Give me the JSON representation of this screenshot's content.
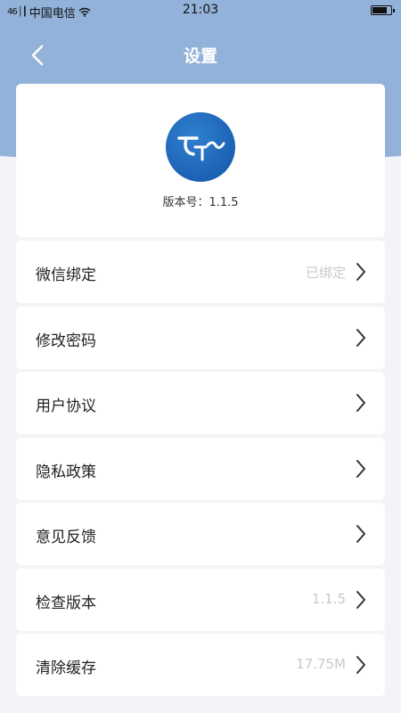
{
  "status": {
    "signal": "46 │┃",
    "carrier": "中国电信",
    "time": "21:03"
  },
  "nav": {
    "title": "设置",
    "back_icon": "chevron-left-icon"
  },
  "about": {
    "logo_icon": "app-logo-icon",
    "version_text": "版本号：1.1.5"
  },
  "settings": [
    {
      "label": "微信绑定",
      "value": "已绑定"
    },
    {
      "label": "修改密码",
      "value": ""
    },
    {
      "label": "用户协议",
      "value": ""
    },
    {
      "label": "隐私政策",
      "value": ""
    },
    {
      "label": "意见反馈",
      "value": ""
    },
    {
      "label": "检查版本",
      "value": "1.1.5"
    },
    {
      "label": "清除缓存",
      "value": "17.75M"
    }
  ],
  "colors": {
    "header": "#93b2d9",
    "logo": "#1e66bd",
    "background": "#f4f4f8"
  }
}
